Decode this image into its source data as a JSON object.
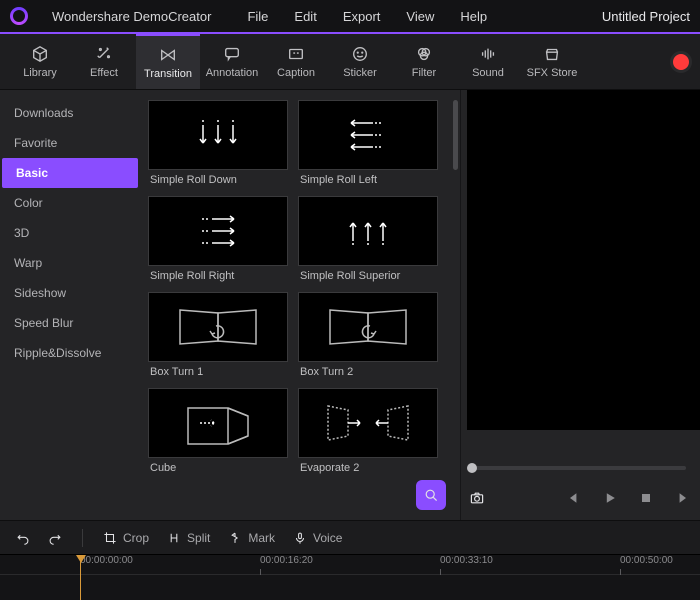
{
  "titlebar": {
    "appname": "Wondershare DemoCreator",
    "menus": [
      "File",
      "Edit",
      "Export",
      "View",
      "Help"
    ],
    "project": "Untitled Project"
  },
  "toolbar": {
    "items": [
      {
        "name": "library",
        "label": "Library",
        "icon": "cube-icon"
      },
      {
        "name": "effect",
        "label": "Effect",
        "icon": "sparkle-icon"
      },
      {
        "name": "transition",
        "label": "Transition",
        "icon": "bowtie-icon",
        "active": true
      },
      {
        "name": "annotation",
        "label": "Annotation",
        "icon": "chat-icon"
      },
      {
        "name": "caption",
        "label": "Caption",
        "icon": "caption-icon"
      },
      {
        "name": "sticker",
        "label": "Sticker",
        "icon": "smiley-icon"
      },
      {
        "name": "filter",
        "label": "Filter",
        "icon": "filter-icon"
      },
      {
        "name": "sound",
        "label": "Sound",
        "icon": "equalizer-icon"
      },
      {
        "name": "sfxstore",
        "label": "SFX Store",
        "icon": "store-icon"
      }
    ]
  },
  "sidebar": {
    "items": [
      "Downloads",
      "Favorite",
      "Basic",
      "Color",
      "3D",
      "Warp",
      "Sideshow",
      "Speed Blur",
      "Ripple&Dissolve"
    ],
    "active_index": 2
  },
  "gallery": {
    "cards": [
      {
        "label": "Simple Roll Down",
        "glyph": "roll-down"
      },
      {
        "label": "Simple Roll Left",
        "glyph": "roll-left"
      },
      {
        "label": "Simple Roll Right",
        "glyph": "roll-right"
      },
      {
        "label": "Simple Roll Superior",
        "glyph": "roll-up"
      },
      {
        "label": "Box Turn 1",
        "glyph": "box-turn-1"
      },
      {
        "label": "Box Turn 2",
        "glyph": "box-turn-2"
      },
      {
        "label": "Cube",
        "glyph": "cube"
      },
      {
        "label": "Evaporate 2",
        "glyph": "evaporate"
      }
    ]
  },
  "lowtool": {
    "undo": "Undo",
    "redo": "Redo",
    "crop": "Crop",
    "split": "Split",
    "mark": "Mark",
    "voice": "Voice"
  },
  "timeline": {
    "ticks": [
      "00:00:00:00",
      "00:00:16:20",
      "00:00:33:10",
      "00:00:50:00"
    ]
  }
}
